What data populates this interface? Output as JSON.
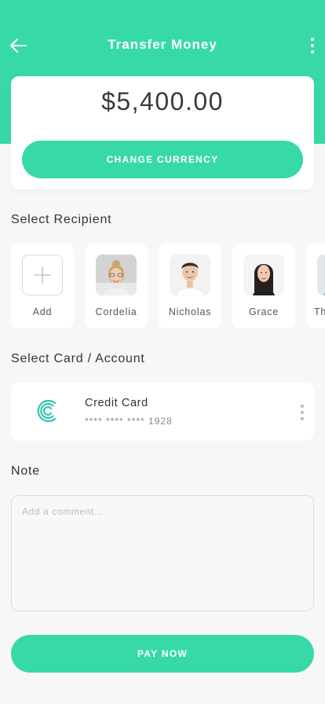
{
  "header": {
    "title": "Transfer Money",
    "back_icon": "arrow-left-icon",
    "more_icon": "more-vertical-icon",
    "color": "#38d9a9"
  },
  "amount_card": {
    "amount": "$5,400.00",
    "change_currency_label": "CHANGE CURRENCY"
  },
  "recipients": {
    "title": "Select Recipient",
    "add_label": "Add",
    "items": [
      {
        "name": "Cordelia"
      },
      {
        "name": "Nicholas"
      },
      {
        "name": "Grace"
      },
      {
        "name": "Th"
      }
    ]
  },
  "card_section": {
    "title": "Select Card / Account",
    "card_name": "Credit Card",
    "card_number": "**** **** **** 1928",
    "logo_icon": "card-brand-c-icon",
    "more_icon": "more-vertical-icon"
  },
  "note": {
    "title": "Note",
    "placeholder": "Add a comment..."
  },
  "pay_button": {
    "label": "PAY NOW"
  }
}
